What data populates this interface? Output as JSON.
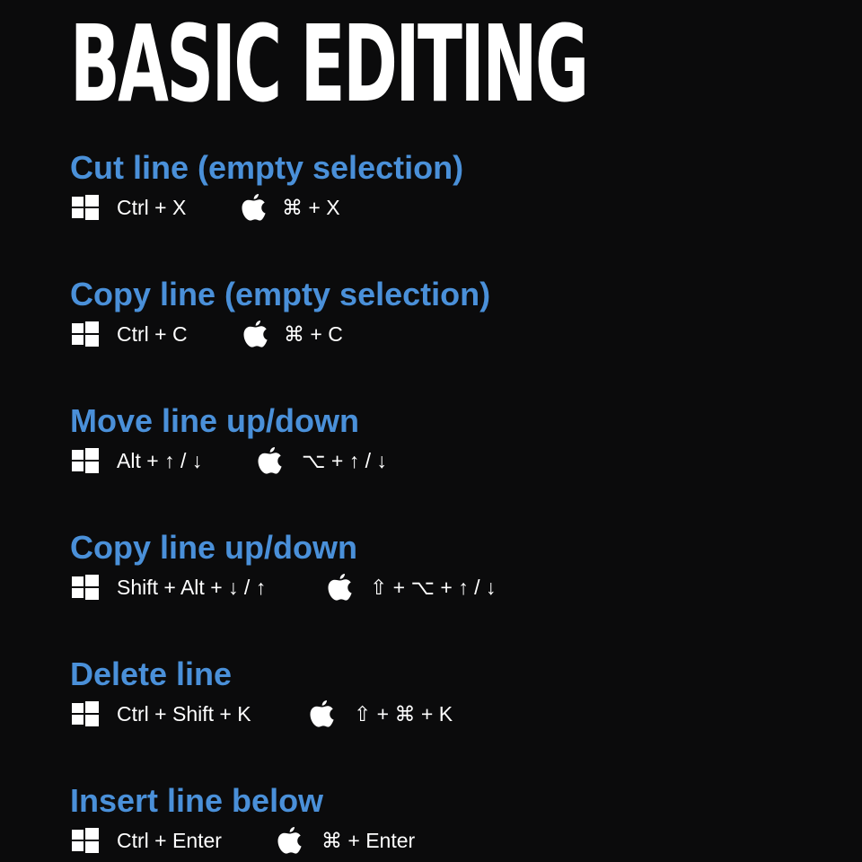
{
  "title": "BASIC EDITING",
  "colors": {
    "background": "#0b0b0c",
    "heading": "#4a90d9",
    "text": "#ffffff"
  },
  "icons": {
    "windows": "windows-icon",
    "apple": "apple-icon"
  },
  "shortcuts": [
    {
      "action": "Cut line (empty selection)",
      "windows": "Ctrl + X",
      "mac": "⌘ + X"
    },
    {
      "action": "Copy line (empty selection)",
      "windows": "Ctrl + C",
      "mac": "⌘ + C"
    },
    {
      "action": "Move line up/down",
      "windows": "Alt + ↑ / ↓",
      "mac": "⌥ + ↑ / ↓"
    },
    {
      "action": "Copy line up/down",
      "windows": "Shift + Alt + ↓ / ↑",
      "mac": "⇧ + ⌥ + ↑ / ↓"
    },
    {
      "action": "Delete line",
      "windows": "Ctrl + Shift + K",
      "mac": "⇧ + ⌘ + K"
    },
    {
      "action": "Insert line below",
      "windows": "Ctrl + Enter",
      "mac": "⌘ + Enter"
    }
  ]
}
